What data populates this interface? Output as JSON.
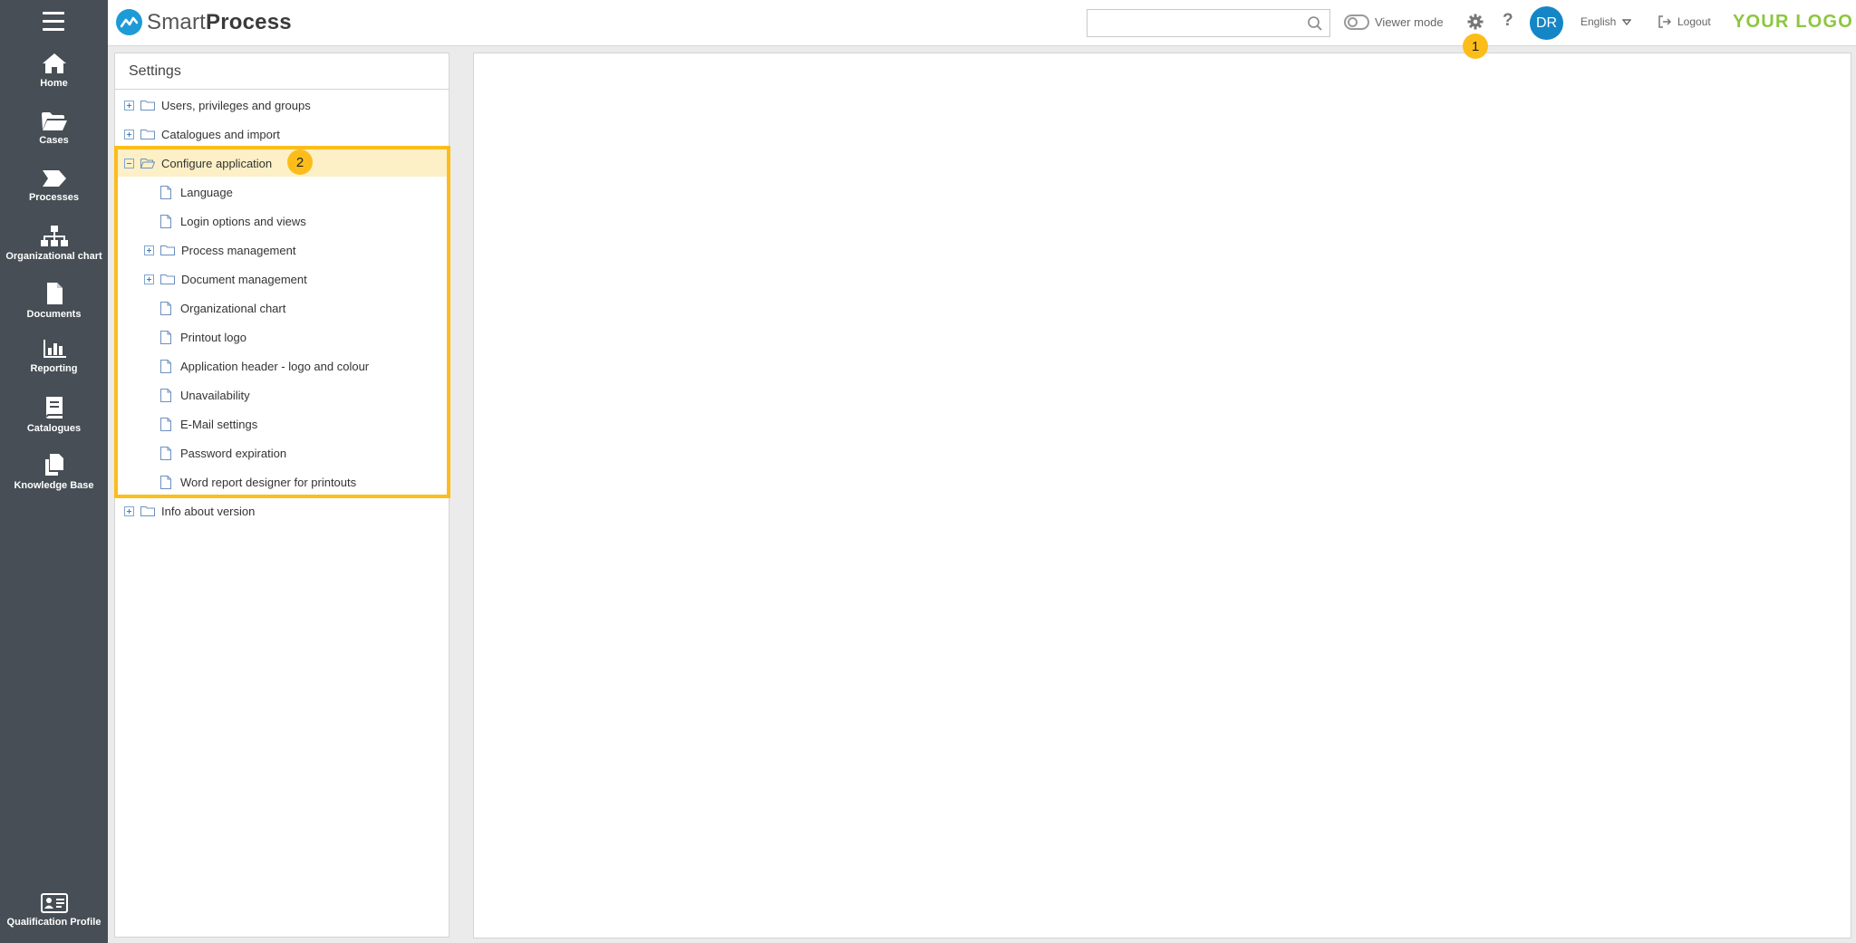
{
  "sidebar": {
    "items": [
      {
        "label": "Home",
        "icon": "home-icon"
      },
      {
        "label": "Cases",
        "icon": "folder-open-icon"
      },
      {
        "label": "Processes",
        "icon": "process-icon"
      },
      {
        "label": "Organizational chart",
        "icon": "org-chart-icon"
      },
      {
        "label": "Documents",
        "icon": "document-icon"
      },
      {
        "label": "Reporting",
        "icon": "bar-chart-icon"
      },
      {
        "label": "Catalogues",
        "icon": "book-icon"
      },
      {
        "label": "Knowledge Base",
        "icon": "copy-icon"
      }
    ],
    "bottom": {
      "label": "Qualification Profile",
      "icon": "id-card-icon"
    }
  },
  "topbar": {
    "brand_light": "Smart",
    "brand_bold": "Process",
    "search_placeholder": "",
    "viewer_mode_label": "Viewer mode",
    "help_label": "?",
    "avatar_initials": "DR",
    "language": "English",
    "logout_label": "Logout",
    "logo_text": "YOUR LOGO"
  },
  "badges": {
    "first": "1",
    "second": "2"
  },
  "settings": {
    "title": "Settings",
    "tree": [
      {
        "label": "Users, privileges and groups",
        "level": 0,
        "type": "folder",
        "expander": "plus"
      },
      {
        "label": "Catalogues and import",
        "level": 0,
        "type": "folder",
        "expander": "plus"
      },
      {
        "label": "Configure application",
        "level": 0,
        "type": "folder-open",
        "expander": "minus",
        "selected": true
      },
      {
        "label": "Language",
        "level": 1,
        "type": "page"
      },
      {
        "label": "Login options and views",
        "level": 1,
        "type": "page"
      },
      {
        "label": "Process management",
        "level": 1,
        "type": "folder",
        "expander": "plus"
      },
      {
        "label": "Document management",
        "level": 1,
        "type": "folder",
        "expander": "plus"
      },
      {
        "label": "Organizational chart",
        "level": 1,
        "type": "page"
      },
      {
        "label": "Printout logo",
        "level": 1,
        "type": "page"
      },
      {
        "label": "Application header - logo and colour",
        "level": 1,
        "type": "page"
      },
      {
        "label": "Unavailability",
        "level": 1,
        "type": "page"
      },
      {
        "label": "E-Mail settings",
        "level": 1,
        "type": "page"
      },
      {
        "label": "Password expiration",
        "level": 1,
        "type": "page"
      },
      {
        "label": "Word report designer for printouts",
        "level": 1,
        "type": "page"
      },
      {
        "label": "Info about version",
        "level": 0,
        "type": "folder",
        "expander": "plus"
      }
    ]
  },
  "colors": {
    "sidebar_bg": "#474e55",
    "brand_blue": "#1d9bd7",
    "avatar_bg": "#1486c6",
    "logo_green": "#8cc63f",
    "highlight": "#fcbd1b",
    "selected_row": "#fdf0c6"
  }
}
